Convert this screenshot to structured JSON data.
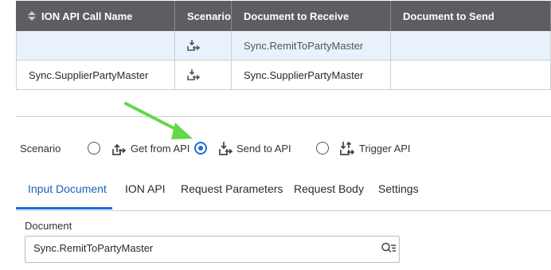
{
  "table": {
    "headers": [
      "ION API Call Name",
      "Scenario",
      "Document to Receive",
      "Document to Send"
    ],
    "rows": [
      {
        "name": "",
        "scenario_icon": "send-to-api-icon",
        "receive": "Sync.RemitToPartyMaster",
        "send": ""
      },
      {
        "name": "Sync.SupplierPartyMaster",
        "scenario_icon": "send-to-api-icon",
        "receive": "Sync.SupplierPartyMaster",
        "send": ""
      }
    ]
  },
  "scenario": {
    "label": "Scenario",
    "options": [
      {
        "label": "Get from API",
        "icon": "get-from-api-icon",
        "selected": false
      },
      {
        "label": "Send to API",
        "icon": "send-to-api-icon",
        "selected": true
      },
      {
        "label": "Trigger API",
        "icon": "trigger-api-icon",
        "selected": false
      }
    ]
  },
  "tabs": [
    "Input Document",
    "ION API",
    "Request Parameters",
    "Request Body",
    "Settings"
  ],
  "active_tab": "Input Document",
  "document": {
    "label": "Document",
    "value": "Sync.RemitToPartyMaster",
    "search_icon": "search-list-icon"
  },
  "annotation": {
    "arrow_color": "#63d84a"
  },
  "colors": {
    "header_bg": "#5d5d63",
    "accent": "#1b6fd6",
    "selected_row": "#e9f1fb"
  }
}
